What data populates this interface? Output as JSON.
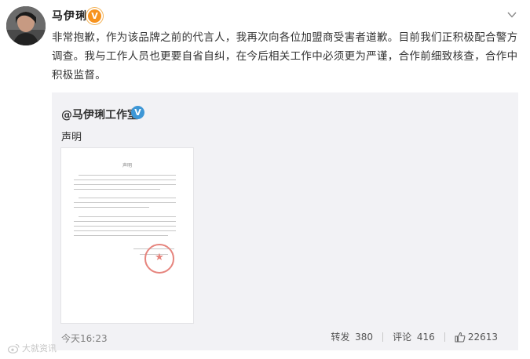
{
  "post": {
    "username": "马伊琍",
    "badge_label": "V",
    "text": "非常抱歉，作为该品牌之前的代言人，我再次向各位加盟商受害者道歉。目前我们正积极配合警方调查。我与工作人员也更要自省自纠，在今后相关工作中必须更为严谨，合作前细致核查，合作中积极监督。"
  },
  "repost": {
    "author": "@马伊琍工作室",
    "badge_label": "V",
    "text": "声明",
    "document": {
      "title": "声明",
      "stamp_symbol": "★"
    },
    "time": "今天16:23",
    "actions": {
      "repost_label": "转发",
      "repost_count": "380",
      "comment_label": "评论",
      "comment_count": "416",
      "like_count": "22613"
    }
  },
  "watermark": {
    "text": "大就资讯"
  },
  "icons": {
    "avatar": "avatar",
    "more": "chevron-down-icon",
    "like": "thumbs-up-icon",
    "watermark": "weibo-logo-icon",
    "stamp": "official-seal-icon"
  },
  "colors": {
    "orange_badge": "#f7931e",
    "blue_badge": "#3e97d6",
    "repost_bg": "#f2f2f5",
    "stamp_red": "#e6847d"
  }
}
